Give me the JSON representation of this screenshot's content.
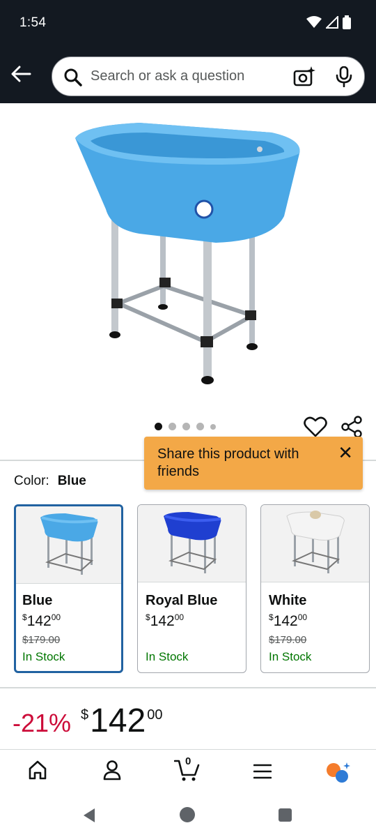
{
  "status_bar": {
    "time": "1:54"
  },
  "search": {
    "placeholder": "Search or ask a question"
  },
  "image_carousel": {
    "total": 5,
    "active": 1
  },
  "tooltip": {
    "text": "Share this product with friends",
    "close": "✕"
  },
  "color_selector": {
    "label": "Color:",
    "selected": "Blue",
    "options": [
      {
        "name": "Blue",
        "price_symbol": "$",
        "price_whole": "142",
        "price_fraction": "00",
        "list_price": "$179.00",
        "availability": "In Stock",
        "color": "#4aa8e6"
      },
      {
        "name": "Royal Blue",
        "price_symbol": "$",
        "price_whole": "142",
        "price_fraction": "00",
        "list_price": "",
        "availability": "In Stock",
        "color": "#1f3fd0"
      },
      {
        "name": "White",
        "price_symbol": "$",
        "price_whole": "142",
        "price_fraction": "00",
        "list_price": "$179.00",
        "availability": "In Stock",
        "color": "#f4f4f4"
      }
    ]
  },
  "price": {
    "discount": "-21%",
    "symbol": "$",
    "whole": "142",
    "fraction": "00"
  },
  "bottom_nav": {
    "cart_count": "0"
  },
  "colors": {
    "header_bg": "#131921",
    "tooltip_bg": "#f3a847",
    "deal_red": "#cc0c39",
    "stock_green": "#007600",
    "selected_border": "#2162a1"
  }
}
